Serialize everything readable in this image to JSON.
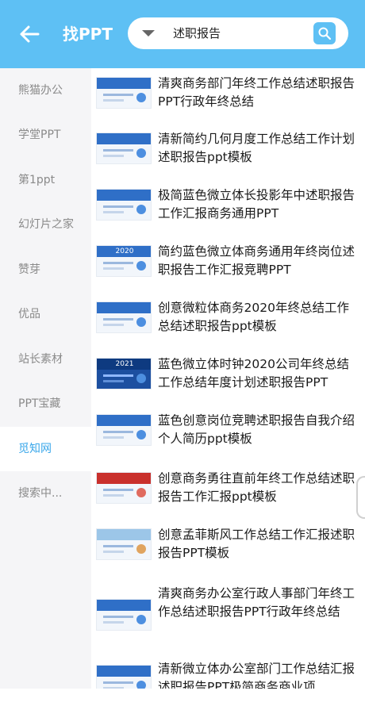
{
  "header": {
    "back_icon": "arrow-left-icon",
    "title": "找PPT",
    "search": {
      "dropdown_icon": "triangle-down-icon",
      "query": "述职报告",
      "search_icon": "search-icon"
    }
  },
  "colors": {
    "header_bg": "#5ec0f4",
    "sidebar_bg": "#f5f5f7",
    "active": "#3aa7ea"
  },
  "sidebar": {
    "items": [
      {
        "label": "熊猫办公",
        "active": false
      },
      {
        "label": "学堂PPT",
        "active": false
      },
      {
        "label": "第1ppt",
        "active": false
      },
      {
        "label": "幻灯片之家",
        "active": false
      },
      {
        "label": "赞芽",
        "active": false
      },
      {
        "label": "优品",
        "active": false
      },
      {
        "label": "站长素材",
        "active": false
      },
      {
        "label": "PPT宝藏",
        "active": false
      },
      {
        "label": "觅知网",
        "active": true
      },
      {
        "label": "搜索中...",
        "active": false
      }
    ]
  },
  "results": [
    {
      "title": "清爽商务部门年终工作总结述职报告PPT行政年终总结"
    },
    {
      "title": "清新简约几何月度工作总结工作计划述职报告ppt模板"
    },
    {
      "title": "极简蓝色微立体长投影年中述职报告工作汇报商务通用PPT"
    },
    {
      "title": "简约蓝色微立体商务通用年终岗位述职报告工作汇报竞聘PPT",
      "thumb_text": "2020"
    },
    {
      "title": "创意微粒体商务2020年终总结工作总结述职报告ppt模板"
    },
    {
      "title": "蓝色微立体时钟2020公司年终总结工作总结年度计划述职报告PPT",
      "thumb_text": "2021"
    },
    {
      "title": "蓝色创意岗位竞聘述职报告自我介绍个人简历ppt模板"
    },
    {
      "title": "创意商务勇往直前年终工作总结述职报告工作汇报ppt模板"
    },
    {
      "title": "创意孟菲斯风工作总结工作汇报述职报告PPT模板"
    },
    {
      "title": "清爽商务办公室行政人事部门年终工作总结述职报告PPT行政年终总结"
    },
    {
      "title": "清新微立体办公室部门工作总结汇报述职报告PPT极简商务商业项"
    }
  ]
}
